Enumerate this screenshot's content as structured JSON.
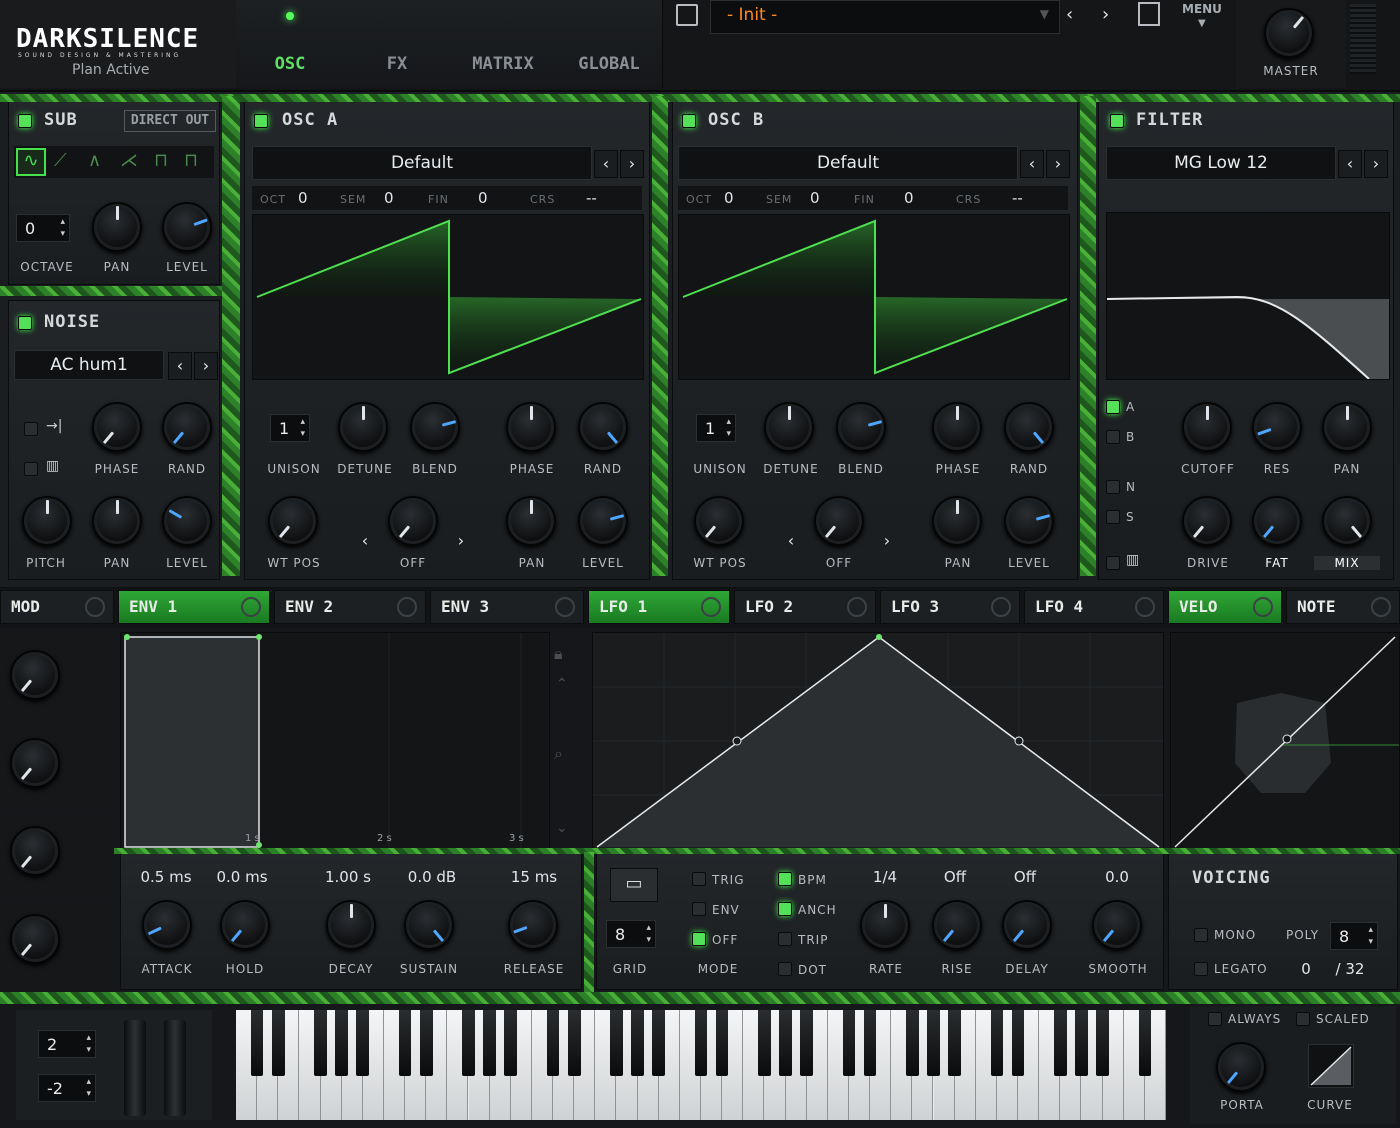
{
  "brand": {
    "name": "DARKSILENCE",
    "tagline": "SOUND DESIGN & MASTERING",
    "status": "Plan Active"
  },
  "nav": {
    "osc": "OSC",
    "fx": "FX",
    "matrix": "MATRIX",
    "global": "GLOBAL"
  },
  "preset": {
    "name": "- Init -",
    "menu": "MENU",
    "master": "MASTER"
  },
  "sub": {
    "title": "SUB",
    "direct_out": "DIRECT OUT",
    "octave_value": "0",
    "octave": "OCTAVE",
    "pan": "PAN",
    "level": "LEVEL"
  },
  "noise": {
    "title": "NOISE",
    "preset": "AC hum1",
    "phase": "PHASE",
    "rand": "RAND",
    "pitch": "PITCH",
    "pan": "PAN",
    "level": "LEVEL"
  },
  "osc_a": {
    "title": "OSC A",
    "wavetable": "Default",
    "oct_label": "OCT",
    "oct": "0",
    "sem_label": "SEM",
    "sem": "0",
    "fin_label": "FIN",
    "fin": "0",
    "crs_label": "CRS",
    "crs": "--",
    "unison_value": "1",
    "unison": "UNISON",
    "detune": "DETUNE",
    "blend": "BLEND",
    "phase": "PHASE",
    "rand": "RAND",
    "wt_pos": "WT POS",
    "warp": "OFF",
    "pan": "PAN",
    "level": "LEVEL"
  },
  "osc_b": {
    "title": "OSC B",
    "wavetable": "Default",
    "oct_label": "OCT",
    "oct": "0",
    "sem_label": "SEM",
    "sem": "0",
    "fin_label": "FIN",
    "fin": "0",
    "crs_label": "CRS",
    "crs": "--",
    "unison_value": "1",
    "unison": "UNISON",
    "detune": "DETUNE",
    "blend": "BLEND",
    "phase": "PHASE",
    "rand": "RAND",
    "wt_pos": "WT POS",
    "warp": "OFF",
    "pan": "PAN",
    "level": "LEVEL"
  },
  "filter": {
    "title": "FILTER",
    "type": "MG Low 12",
    "a": "A",
    "b": "B",
    "n": "N",
    "s": "S",
    "cutoff": "CUTOFF",
    "res": "RES",
    "pan": "PAN",
    "drive": "DRIVE",
    "fat": "FAT",
    "mix": "MIX"
  },
  "tabs": {
    "mod": "MOD",
    "env1": "ENV 1",
    "env2": "ENV 2",
    "env3": "ENV 3",
    "lfo1": "LFO 1",
    "lfo2": "LFO 2",
    "lfo3": "LFO 3",
    "lfo4": "LFO 4",
    "velo": "VELO",
    "note": "NOTE"
  },
  "env": {
    "t1": "1 s",
    "t2": "2 s",
    "t3": "3 s",
    "attack_value": "0.5 ms",
    "hold_value": "0.0 ms",
    "decay_value": "1.00 s",
    "sustain_value": "0.0 dB",
    "release_value": "15 ms",
    "attack": "ATTACK",
    "hold": "HOLD",
    "decay": "DECAY",
    "sustain": "SUSTAIN",
    "release": "RELEASE"
  },
  "lfo": {
    "grid_value": "8",
    "grid": "GRID",
    "trig": "TRIG",
    "env": "ENV",
    "off": "OFF",
    "mode": "MODE",
    "bpm": "BPM",
    "anch": "ANCH",
    "trip": "TRIP",
    "dot": "DOT",
    "rate_value": "1/4",
    "rise_value": "Off",
    "delay_value": "Off",
    "smooth_value": "0.0",
    "rate": "RATE",
    "rise": "RISE",
    "delay": "DELAY",
    "smooth": "SMOOTH"
  },
  "voicing": {
    "title": "VOICING",
    "mono": "MONO",
    "poly": "POLY",
    "poly_value": "8",
    "legato": "LEGATO",
    "legato_value": "0",
    "voices": "/ 32",
    "always": "ALWAYS",
    "scaled": "SCALED",
    "porta": "PORTA",
    "curve": "CURVE"
  },
  "keyboard": {
    "bend_up": "2",
    "bend_down": "-2"
  },
  "colors": {
    "accent": "#47e04d",
    "bg": "#0d0f10",
    "panel": "#1e2124"
  }
}
